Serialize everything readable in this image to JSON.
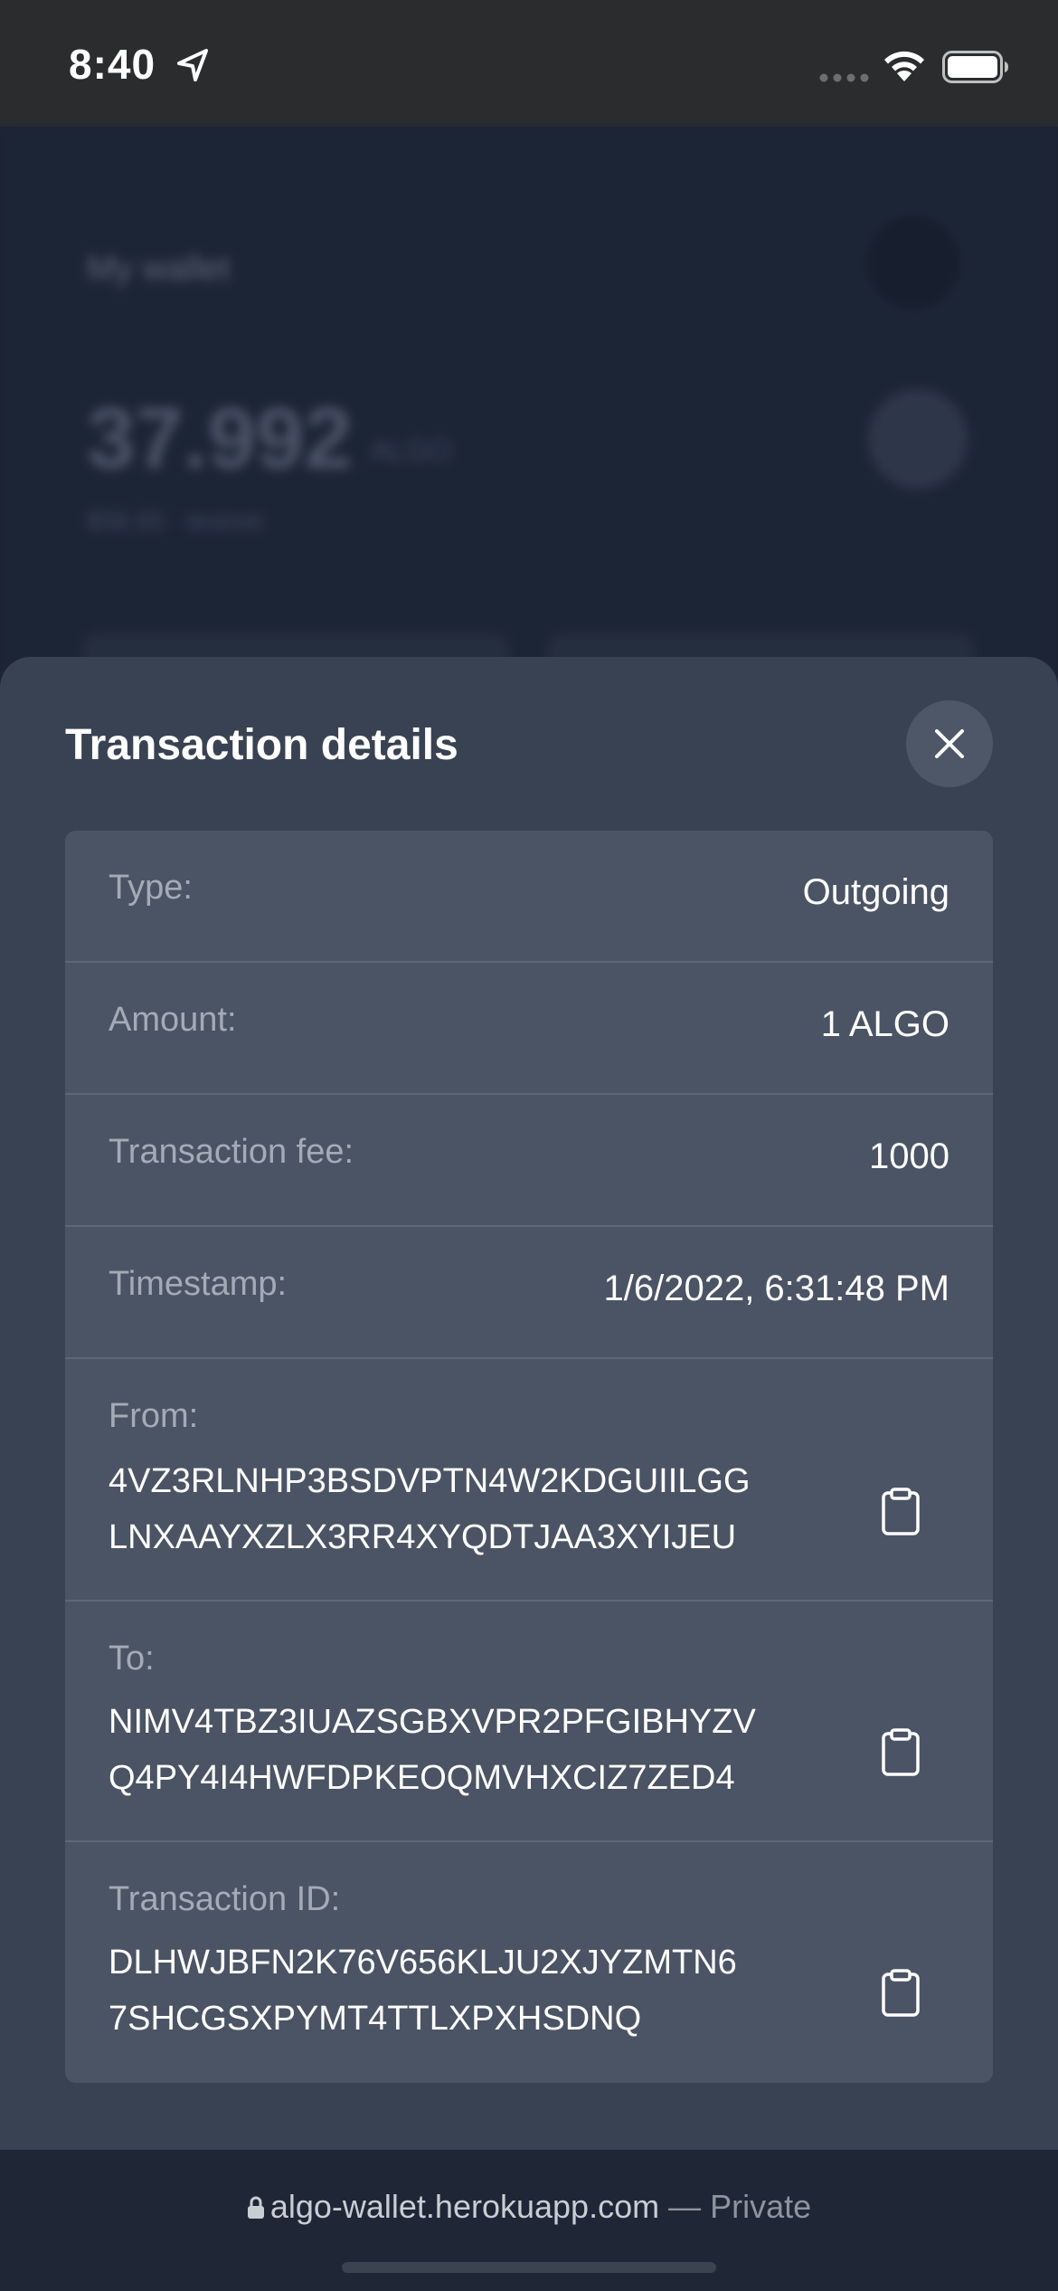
{
  "status_bar": {
    "time": "8:40",
    "icons": [
      "location-arrow-icon",
      "signal-icon",
      "wifi-icon",
      "battery-icon"
    ]
  },
  "background_app": {
    "title": "My wallet",
    "balance": "37.992",
    "unit": "ALGO",
    "sub": "$58.65 · testnet"
  },
  "sheet": {
    "title": "Transaction details",
    "close_icon": "close-icon",
    "rows": [
      {
        "label": "Type:",
        "value": "Outgoing"
      },
      {
        "label": "Amount:",
        "value": "1 ALGO"
      },
      {
        "label": "Transaction fee:",
        "value": "1000"
      },
      {
        "label": "Timestamp:",
        "value": "1/6/2022, 6:31:48 PM"
      }
    ],
    "from": {
      "label": "From:",
      "line1": "4VZ3RLNHP3BSDVPTN4W2KDGUIILGG",
      "line2": "LNXAAYXZLX3RR4XYQDTJAA3XYIJEU"
    },
    "to": {
      "label": "To:",
      "line1": "NIMV4TBZ3IUAZSGBXVPR2PFGIBHYZV",
      "line2": "Q4PY4I4HWFDPKEOQMVHXCIZ7ZED4"
    },
    "transaction_id": {
      "label": "Transaction ID:",
      "line1": "DLHWJBFN2K76V656KLJU2XJYZMTN6",
      "line2": "7SHCGSXPYMT4TTLXPXHSDNQ"
    }
  },
  "browser_bar": {
    "url": "algo-wallet.herokuapp.com",
    "separator": " — ",
    "mode": "Private"
  },
  "colors": {
    "sheet_bg": "#384252",
    "card_bg": "#4b5464",
    "label": "#a4abb7",
    "value": "#ffffff"
  }
}
